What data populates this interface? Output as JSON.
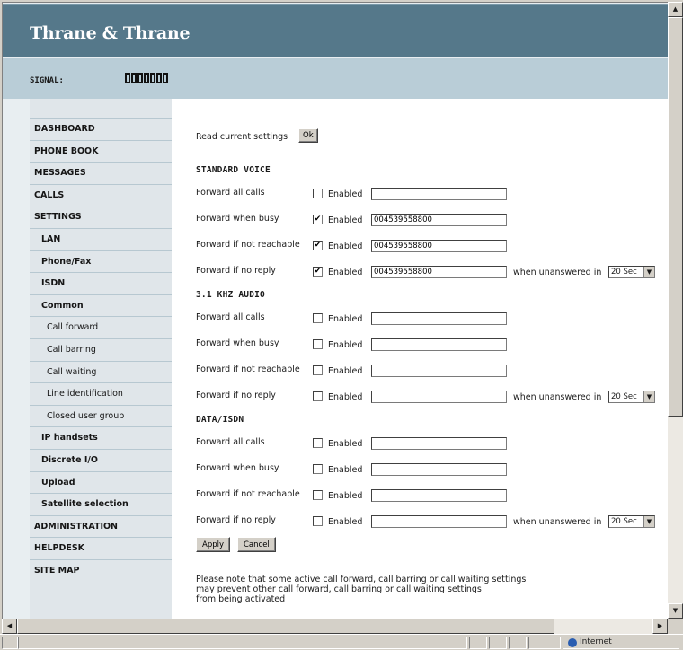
{
  "header": {
    "brand": "Thrane & Thrane",
    "signal_label": "SIGNAL:",
    "signal_level": "0 of 7"
  },
  "sidebar": {
    "items": [
      {
        "label": "DASHBOARD",
        "level": 0
      },
      {
        "label": "PHONE BOOK",
        "level": 0
      },
      {
        "label": "MESSAGES",
        "level": 0
      },
      {
        "label": "CALLS",
        "level": 0
      },
      {
        "label": "SETTINGS",
        "level": 0
      },
      {
        "label": "LAN",
        "level": 1
      },
      {
        "label": "Phone/Fax",
        "level": 1
      },
      {
        "label": "ISDN",
        "level": 1
      },
      {
        "label": "Common",
        "level": 1
      },
      {
        "label": "Call forward",
        "level": 2
      },
      {
        "label": "Call barring",
        "level": 2
      },
      {
        "label": "Call waiting",
        "level": 2
      },
      {
        "label": "Line identification",
        "level": 2
      },
      {
        "label": "Closed user group",
        "level": 2
      },
      {
        "label": "IP handsets",
        "level": 1
      },
      {
        "label": "Discrete I/O",
        "level": 1
      },
      {
        "label": "Upload",
        "level": 1
      },
      {
        "label": "Satellite selection",
        "level": 1
      },
      {
        "label": "ADMINISTRATION",
        "level": 0
      },
      {
        "label": "HELPDESK",
        "level": 0
      },
      {
        "label": "SITE MAP",
        "level": 0
      }
    ]
  },
  "form": {
    "read_label": "Read current settings",
    "ok_label": "Ok",
    "enabled_label": "Enabled",
    "unanswered_label": "when unanswered in",
    "sections": [
      {
        "title": "STANDARD VOICE",
        "rows": [
          {
            "label": "Forward all calls",
            "checked": false,
            "number": ""
          },
          {
            "label": "Forward when busy",
            "checked": true,
            "number": "004539558800"
          },
          {
            "label": "Forward if not reachable",
            "checked": true,
            "number": "004539558800"
          },
          {
            "label": "Forward if no reply",
            "checked": true,
            "number": "004539558800",
            "delay": "20 Sec"
          }
        ]
      },
      {
        "title": "3.1 KHZ AUDIO",
        "rows": [
          {
            "label": "Forward all calls",
            "checked": false,
            "number": ""
          },
          {
            "label": "Forward when busy",
            "checked": false,
            "number": ""
          },
          {
            "label": "Forward if not reachable",
            "checked": false,
            "number": ""
          },
          {
            "label": "Forward if no reply",
            "checked": false,
            "number": "",
            "delay": "20 Sec"
          }
        ]
      },
      {
        "title": "DATA/ISDN",
        "rows": [
          {
            "label": "Forward all calls",
            "checked": false,
            "number": ""
          },
          {
            "label": "Forward when busy",
            "checked": false,
            "number": ""
          },
          {
            "label": "Forward if not reachable",
            "checked": false,
            "number": ""
          },
          {
            "label": "Forward if no reply",
            "checked": false,
            "number": "",
            "delay": "20 Sec"
          }
        ]
      }
    ],
    "apply_label": "Apply",
    "cancel_label": "Cancel",
    "note_lines": [
      "Please note that some active call forward, call barring or call waiting settings",
      "may prevent other call forward, call barring or call waiting settings",
      "from being activated"
    ]
  },
  "statusbar": {
    "zone": "Internet"
  }
}
